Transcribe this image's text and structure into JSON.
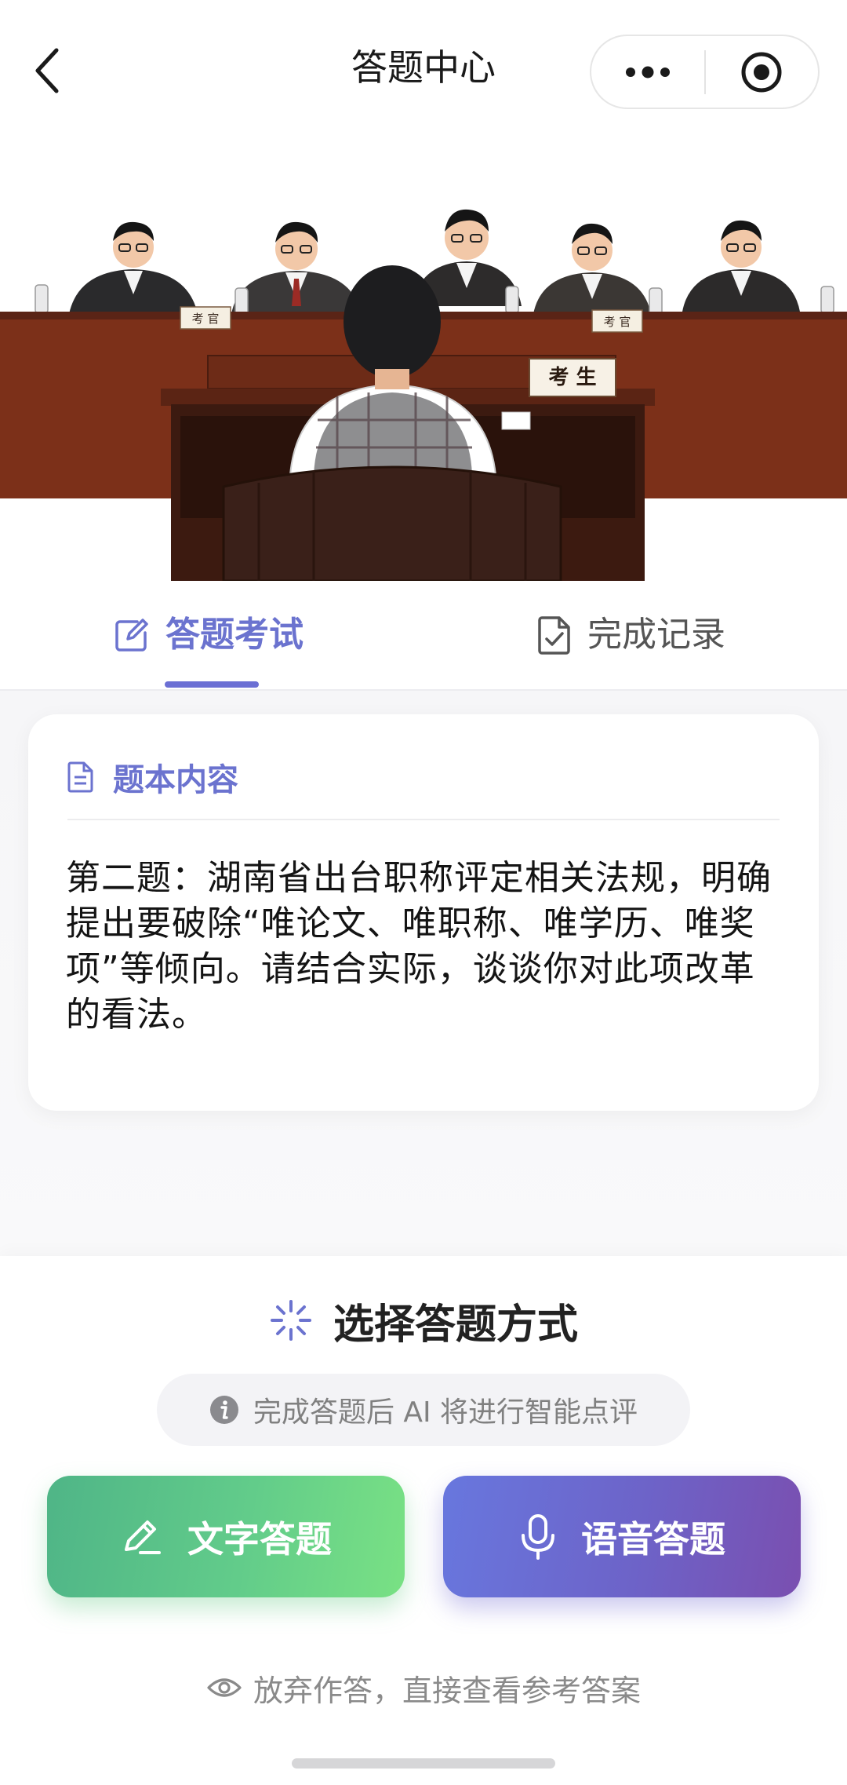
{
  "header": {
    "title": "答题中心",
    "back_icon": "chevron-left-icon",
    "more_icon": "more-dots-icon",
    "close_icon": "target-circle-icon"
  },
  "illustration": {
    "desc_icon": "exam-interview-illustration",
    "nameplate_examiner_left": "考 官",
    "nameplate_examiner_right": "考 官",
    "nameplate_candidate": "考 生"
  },
  "tabs": [
    {
      "label": "答题考试",
      "icon": "edit-icon",
      "active": true
    },
    {
      "label": "完成记录",
      "icon": "doc-check-icon",
      "active": false
    }
  ],
  "question_card": {
    "title": "题本内容",
    "title_icon": "document-icon",
    "text": "第二题：湖南省出台职称评定相关法规，明确提出要破除“唯论文、唯职称、唯学历、唯奖项”等倾向。请结合实际，谈谈你对此项改革的看法。"
  },
  "answer_mode": {
    "title": "选择答题方式",
    "title_icon": "sparkle-icon",
    "hint": "完成答题后 AI 将进行智能点评",
    "hint_icon": "info-icon",
    "text_button": "文字答题",
    "text_button_icon": "pen-icon",
    "voice_button": "语音答题",
    "voice_button_icon": "microphone-icon",
    "skip": "放弃作答，直接查看参考答案",
    "skip_icon": "eye-icon"
  },
  "colors": {
    "accent": "#6b73cf",
    "text_button_gradient": [
      "#4fb587",
      "#79e184"
    ],
    "voice_button_gradient": [
      "#6877de",
      "#7a4fb0"
    ]
  }
}
